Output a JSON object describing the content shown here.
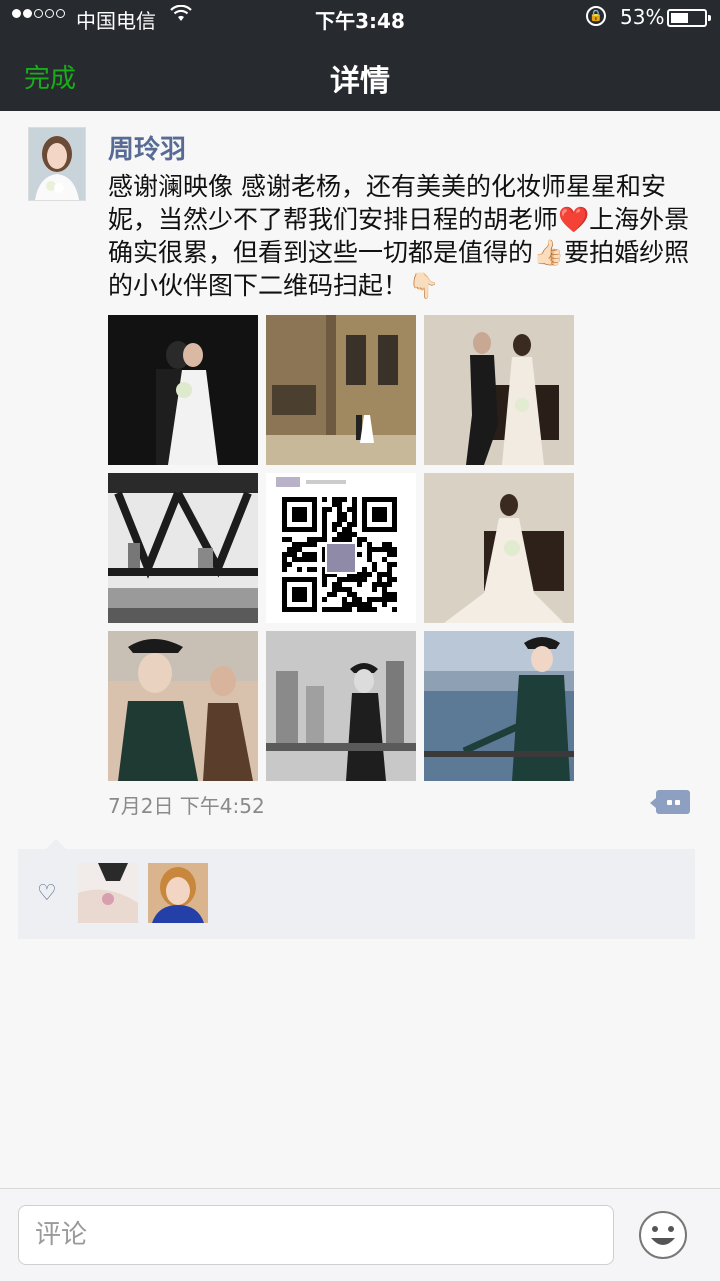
{
  "status_bar": {
    "carrier": "中国电信",
    "time": "下午3:48",
    "battery": "53%",
    "battery_level": 0.53
  },
  "nav": {
    "done": "完成",
    "title": "详情"
  },
  "post": {
    "author": "周玲羽",
    "text": "感谢澜映像 感谢老杨，还有美美的化妆师星星和安妮，当然少不了帮我们安排日程的胡老师❤️上海外景确实很累，但看到这些一切都是值得的👍🏻要拍婚纱照的小伙伴图下二维码扫起！👇🏻",
    "time": "7月2日 下午4:52",
    "photos": [
      "wedding-photo-1",
      "wedding-photo-2",
      "wedding-photo-3",
      "wedding-photo-4",
      "qr-code",
      "wedding-photo-5",
      "wedding-photo-6",
      "wedding-photo-7",
      "wedding-photo-8"
    ]
  },
  "likes": {
    "icon": "heart-icon",
    "avatars": [
      "liker-avatar-1",
      "liker-avatar-2"
    ]
  },
  "comment_bar": {
    "placeholder": "评论",
    "emoji_icon": "smiley-icon"
  },
  "colors": {
    "accent": "#1aad19",
    "name_blue": "#576b95",
    "nav_bg": "#272a2f"
  }
}
